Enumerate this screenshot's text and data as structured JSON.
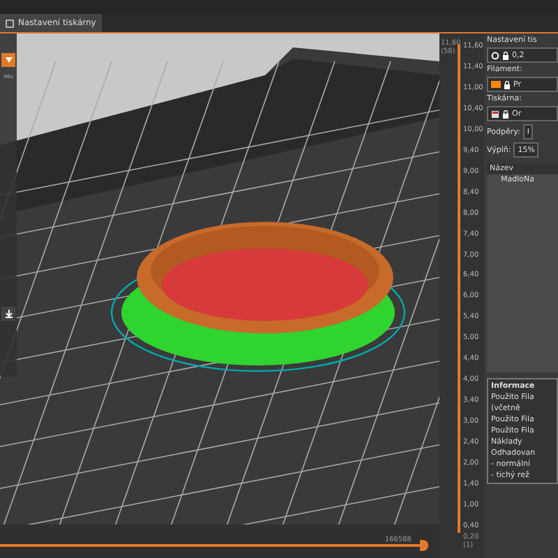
{
  "tabs": [
    {
      "label": "Nastavení tiskárny",
      "selected": true
    }
  ],
  "left_toolbar": {
    "label": "ntu"
  },
  "horizontal_slider": {
    "reading": "166588",
    "level": 1
  },
  "vertical_slider": {
    "top_reading": "11,60",
    "top_layer": "(58)",
    "bottom_reading": "0,20",
    "bottom_layer": "(1)",
    "level": 1,
    "ticks": [
      "11,60",
      "11,40",
      "11,00",
      "10,40",
      "10,00",
      "9,40",
      "9,00",
      "8,40",
      "8,00",
      "7,40",
      "7,00",
      "6,40",
      "6,00",
      "5,40",
      "5,00",
      "4,40",
      "4,00",
      "3,40",
      "3,00",
      "2,40",
      "2,00",
      "1,40",
      "1,00",
      "0,40"
    ]
  },
  "sidebar": {
    "title": "Nastavení tis",
    "print_value": "0,2",
    "filament_label": "Filament:",
    "filaments": [
      {
        "value": "Pr",
        "color": "#ff8a00"
      }
    ],
    "printer_label": "Tiskárna:",
    "printer_value": "Or",
    "supports_label": "Podpěry:",
    "supports_value": "I",
    "infill_label": "Výplň:",
    "infill_value": "15%",
    "table": {
      "columns": [
        "Název"
      ],
      "rows": [
        "MadloNa"
      ]
    },
    "info": {
      "title": "Informace",
      "lines": [
        "Použito Fila",
        "(včetně",
        "Použito Fila",
        "Použito Fila",
        "Náklady",
        "Odhadovan",
        "- normální",
        "- tichý rež"
      ]
    }
  }
}
